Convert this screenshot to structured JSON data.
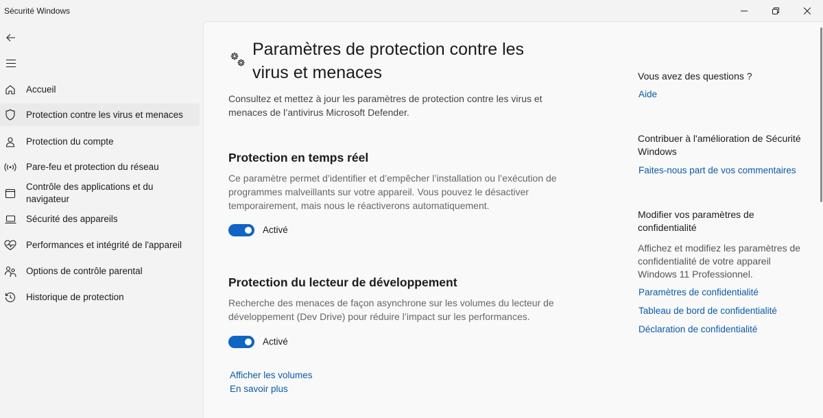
{
  "window": {
    "title": "Sécurité Windows",
    "controls": [
      "minimize-icon",
      "restore-icon",
      "close-icon"
    ]
  },
  "nav": {
    "back_icon": "back-arrow-icon",
    "menu_icon": "hamburger-menu-icon",
    "items": [
      {
        "label": "Accueil",
        "icon": "home-icon"
      },
      {
        "label": "Protection contre les virus et menaces",
        "icon": "shield-icon",
        "selected": true
      },
      {
        "label": "Protection du compte",
        "icon": "person-icon"
      },
      {
        "label": "Pare-feu et protection du réseau",
        "icon": "wifi-signal-icon"
      },
      {
        "label": "Contrôle des applications et du navigateur",
        "icon": "app-window-icon"
      },
      {
        "label": "Sécurité des appareils",
        "icon": "laptop-icon"
      },
      {
        "label": "Performances et intégrité de l'appareil",
        "icon": "heart-pulse-icon"
      },
      {
        "label": "Options de contrôle parental",
        "icon": "family-icon"
      },
      {
        "label": "Historique de protection",
        "icon": "history-icon"
      }
    ]
  },
  "main": {
    "header_icon": "gears-icon",
    "title": "Paramètres de protection contre les virus et menaces",
    "subtitle": "Consultez et mettez à jour les paramètres de protection contre les virus et menaces de l’antivirus Microsoft Defender.",
    "sections": [
      {
        "title": "Protection en temps réel",
        "description": "Ce paramètre permet d’identifier et d’empêcher l’installation ou l’exécution de programmes malveillants sur votre appareil. Vous pouvez le désactiver temporairement, mais nous le réactiverons automatiquement.",
        "toggle_state": "on",
        "toggle_label": "Activé"
      },
      {
        "title": "Protection du lecteur de développement",
        "description": "Recherche des menaces de façon asynchrone sur les volumes du lecteur de développement (Dev Drive) pour réduire l’impact sur les performances.",
        "toggle_state": "on",
        "toggle_label": "Activé",
        "links": [
          "Afficher les volumes",
          "En savoir plus"
        ]
      }
    ],
    "accent_color": "#0f64c6",
    "link_color": "#0a5aa8"
  },
  "right": {
    "questions": {
      "heading": "Vous avez des questions ?",
      "link": "Aide"
    },
    "contribute": {
      "heading": "Contribuer à l'amélioration de Sécurité Windows",
      "link": "Faites-nous part de vos commentaires"
    },
    "privacy": {
      "heading": "Modifier vos paramètres de confidentialité",
      "text": "Affichez et modifiez les paramètres de confidentialité de votre appareil Windows 11 Professionnel.",
      "links": [
        "Paramètres de confidentialité",
        "Tableau de bord de confidentialité",
        "Déclaration de confidentialité"
      ]
    }
  }
}
